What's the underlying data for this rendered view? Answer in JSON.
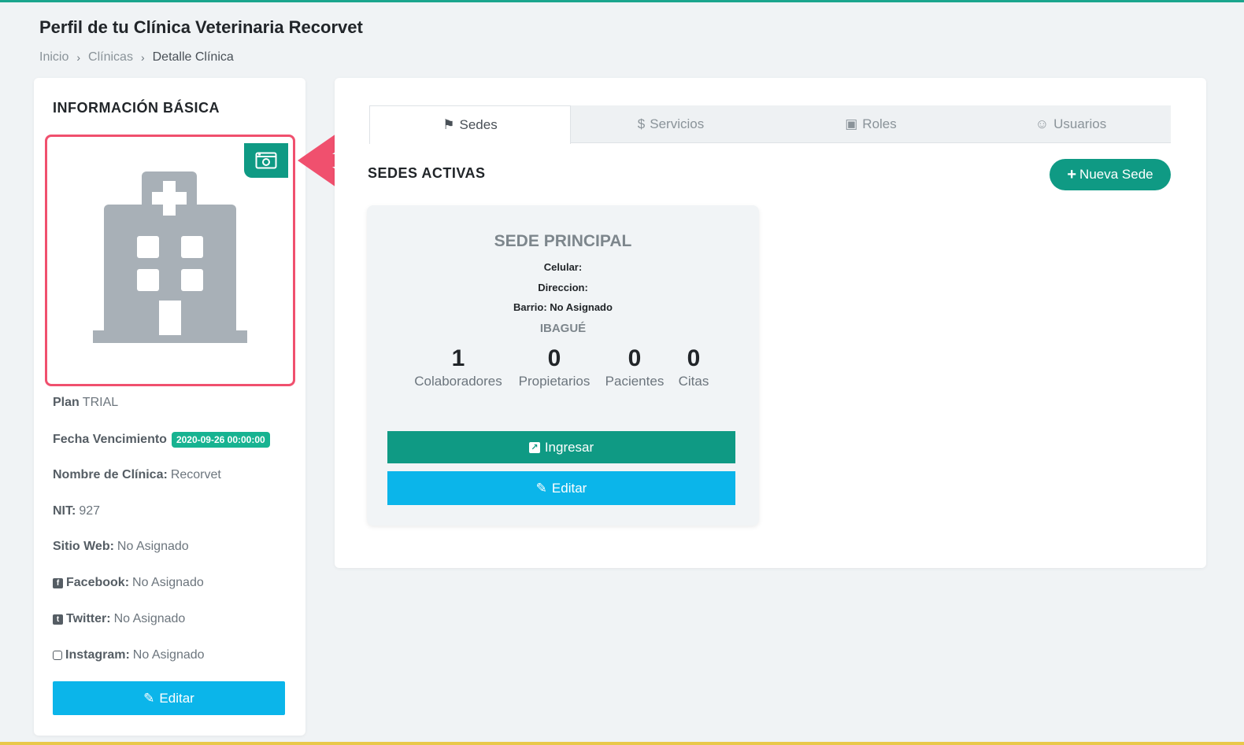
{
  "header": {
    "title": "Perfil de tu Clínica Veterinaria Recorvet",
    "breadcrumb": [
      "Inicio",
      "Clínicas",
      "Detalle Clínica"
    ]
  },
  "basic_info": {
    "title": "INFORMACIÓN BÁSICA",
    "plan_label": "Plan",
    "plan_value": "TRIAL",
    "expiry_label": "Fecha Vencimiento",
    "expiry_value": "2020-09-26 00:00:00",
    "clinic_name_label": "Nombre de Clínica:",
    "clinic_name_value": "Recorvet",
    "nit_label": "NIT:",
    "nit_value": "927",
    "website_label": "Sitio Web:",
    "website_value": "No Asignado",
    "facebook_label": "Facebook:",
    "facebook_value": "No Asignado",
    "twitter_label": "Twitter:",
    "twitter_value": "No Asignado",
    "instagram_label": "Instagram:",
    "instagram_value": "No Asignado",
    "edit_label": "Editar"
  },
  "tabs": [
    {
      "label": "Sedes",
      "icon": "signpost-icon",
      "active": true
    },
    {
      "label": "Servicios",
      "icon": "dollar-icon",
      "active": false
    },
    {
      "label": "Roles",
      "icon": "id-card-icon",
      "active": false
    },
    {
      "label": "Usuarios",
      "icon": "user-doctor-icon",
      "active": false
    }
  ],
  "sedes": {
    "title": "SEDES ACTIVAS",
    "new_label": "Nueva Sede",
    "card": {
      "name": "SEDE PRINCIPAL",
      "phone_label": "Celular:",
      "address_label": "Direccion:",
      "district_label": "Barrio: No Asignado",
      "city": "IBAGUÉ",
      "stats": [
        {
          "value": "1",
          "label": "Colaboradores"
        },
        {
          "value": "0",
          "label": "Propietarios"
        },
        {
          "value": "0",
          "label": "Pacientes"
        },
        {
          "value": "0",
          "label": "Citas"
        }
      ],
      "enter_label": "Ingresar",
      "edit_label": "Editar"
    }
  },
  "colors": {
    "accent": "#0f9a84",
    "cyan": "#0bb5ea",
    "highlight": "#f0506e",
    "badge": "#17b391"
  }
}
